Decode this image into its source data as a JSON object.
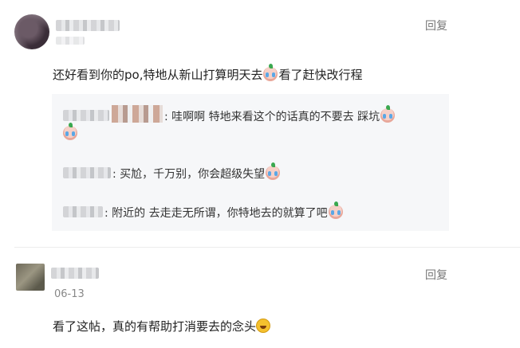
{
  "comments": [
    {
      "author": "",
      "reply_label": "回复",
      "text_before_emoji": "还好看到你的po,特地从新山打算明天去",
      "text_after_emoji": "看了赶快改行程",
      "sub_replies": [
        {
          "name": "",
          "text": ": 哇啊啊 特地来看这个的话真的不要去 踩坑"
        },
        {
          "name": "",
          "text": ": 买尬，千万别，你会超级失望"
        },
        {
          "name": "",
          "text": ": 附近的 去走走无所谓，你特地去的就算了吧"
        }
      ]
    },
    {
      "author": "",
      "date": "06-13",
      "reply_label": "回复",
      "text": "看了这帖，真的有帮助打消要去的念头"
    }
  ]
}
